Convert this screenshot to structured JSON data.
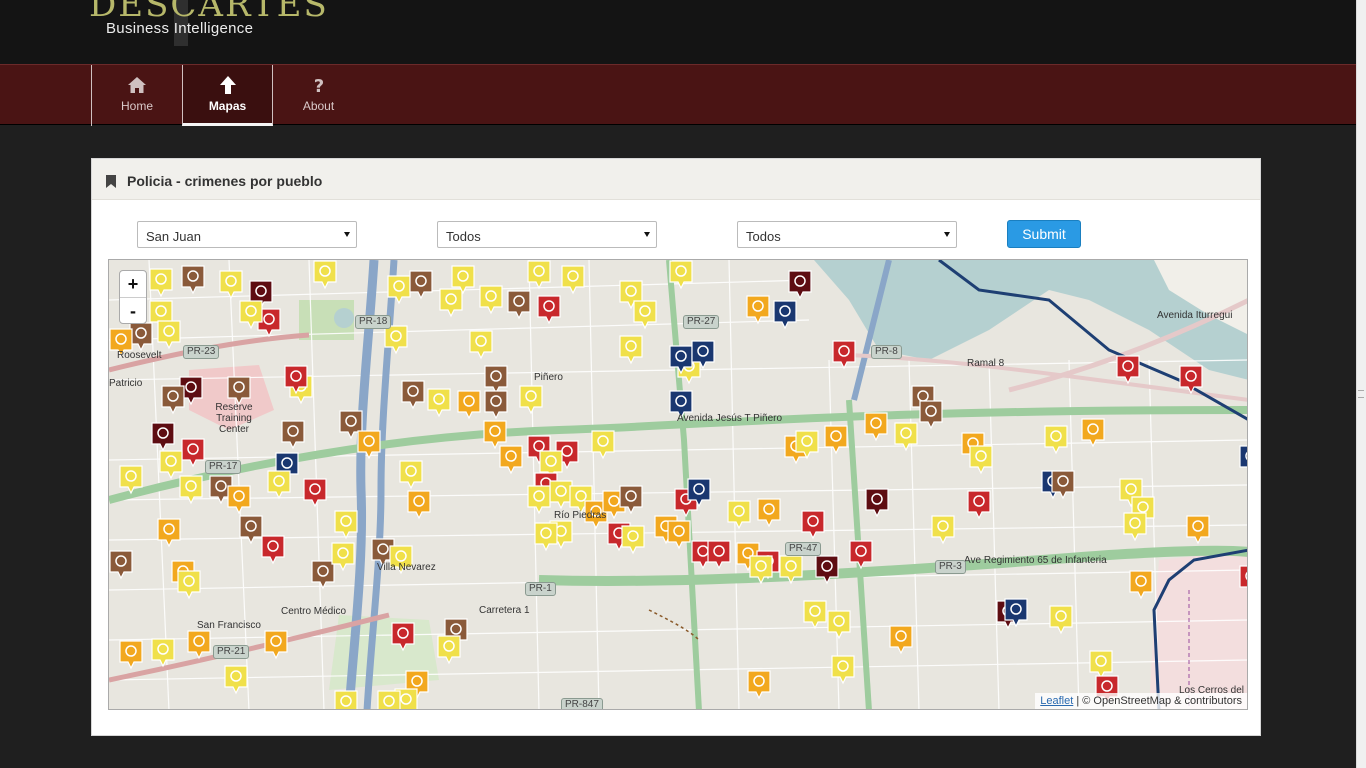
{
  "brand": {
    "title": "DESCARTES",
    "subtitle": "Business Intelligence"
  },
  "nav": [
    {
      "label": "Home",
      "icon": "home-icon",
      "active": false
    },
    {
      "label": "Mapas",
      "icon": "arrow-up-icon",
      "active": true
    },
    {
      "label": "About",
      "icon": "question-icon",
      "active": false
    }
  ],
  "panel": {
    "title": "Policia - crimenes por pueblo",
    "icon": "bookmark-icon"
  },
  "filters": {
    "pueblo": "San Juan",
    "crimen": "Todos",
    "tipo": "Todos",
    "submit_label": "Submit"
  },
  "map": {
    "zoom_in": "+",
    "zoom_out": "-",
    "attribution_link": "Leaflet",
    "attribution_text": " | © OpenStreetMap & contributors",
    "labels": [
      "Piñero",
      "Reserve Training Center",
      "Centro Médico",
      "San Francisco",
      "Villa Nevarez",
      "Avenida Jesús T Piñero",
      "Ramal 8",
      "Ave Regimiento 65 de Infanteria",
      "Avenida Iturregui",
      "Los Cerros del",
      "Río Piedras",
      "Patricio",
      "Roosevelt",
      "Carretera 1"
    ],
    "roads": [
      "PR-18",
      "PR-23",
      "PR-17",
      "PR-27",
      "PR-8",
      "PR-3",
      "PR-1",
      "PR-21",
      "PR-47",
      "PR-847"
    ],
    "marker_legend_colors": {
      "robbery": "#f0e04a",
      "burglary": "#f2a81e",
      "assault": "#c8282c",
      "vehicle_theft": "#8a5a3a",
      "homicide": "#5e0d12",
      "other": "#1a3770"
    }
  }
}
